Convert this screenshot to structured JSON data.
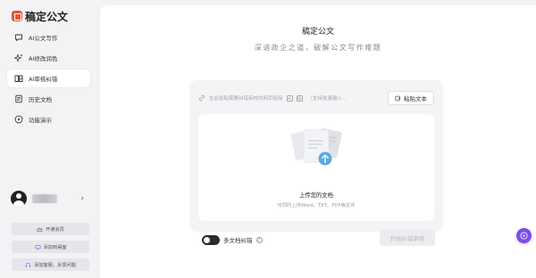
{
  "brand": {
    "name": "稿定公文",
    "logo_icon": "logo-icon",
    "logo_color": "#e8553a"
  },
  "sidebar": {
    "items": [
      {
        "label": "AI公文写作",
        "icon": "chat-icon",
        "active": false
      },
      {
        "label": "AI修改润色",
        "icon": "sparkle-icon",
        "active": false
      },
      {
        "label": "AI审核纠错",
        "icon": "book-check-icon",
        "active": true
      },
      {
        "label": "历史文档",
        "icon": "document-icon",
        "active": false
      },
      {
        "label": "功能演示",
        "icon": "play-icon",
        "active": false
      }
    ],
    "user": {
      "name_blurred": true,
      "arrow": "›"
    },
    "buttons": [
      {
        "label": "开通会员",
        "icon": "crown-icon"
      },
      {
        "label": "添加到桌面",
        "icon": "monitor-icon"
      },
      {
        "label": "添加客服，反馈问题",
        "icon": "headset-icon"
      }
    ]
  },
  "main": {
    "title": "稿定公文",
    "subtitle": "深谙政企之道，破解公文写作难题"
  },
  "link_input": {
    "placeholder": "在此粘贴需要纠错审核的网页链接",
    "mini_icon_1": "+",
    "mini_icon_2": "⇆",
    "hint": "（支持批量输入…",
    "paste_label": "粘贴文本"
  },
  "upload": {
    "title": "上传您的文档",
    "hint": "可同时上传Word、TXT、PDF等文件"
  },
  "options": {
    "multi_doc_label": "多文档纠错",
    "multi_doc_enabled": true,
    "start_label": "开始纠错审核"
  },
  "colors": {
    "accent": "#7b4ee8",
    "toggle": "#2b2b2b",
    "upload_arrow": "#5aa9e6"
  }
}
